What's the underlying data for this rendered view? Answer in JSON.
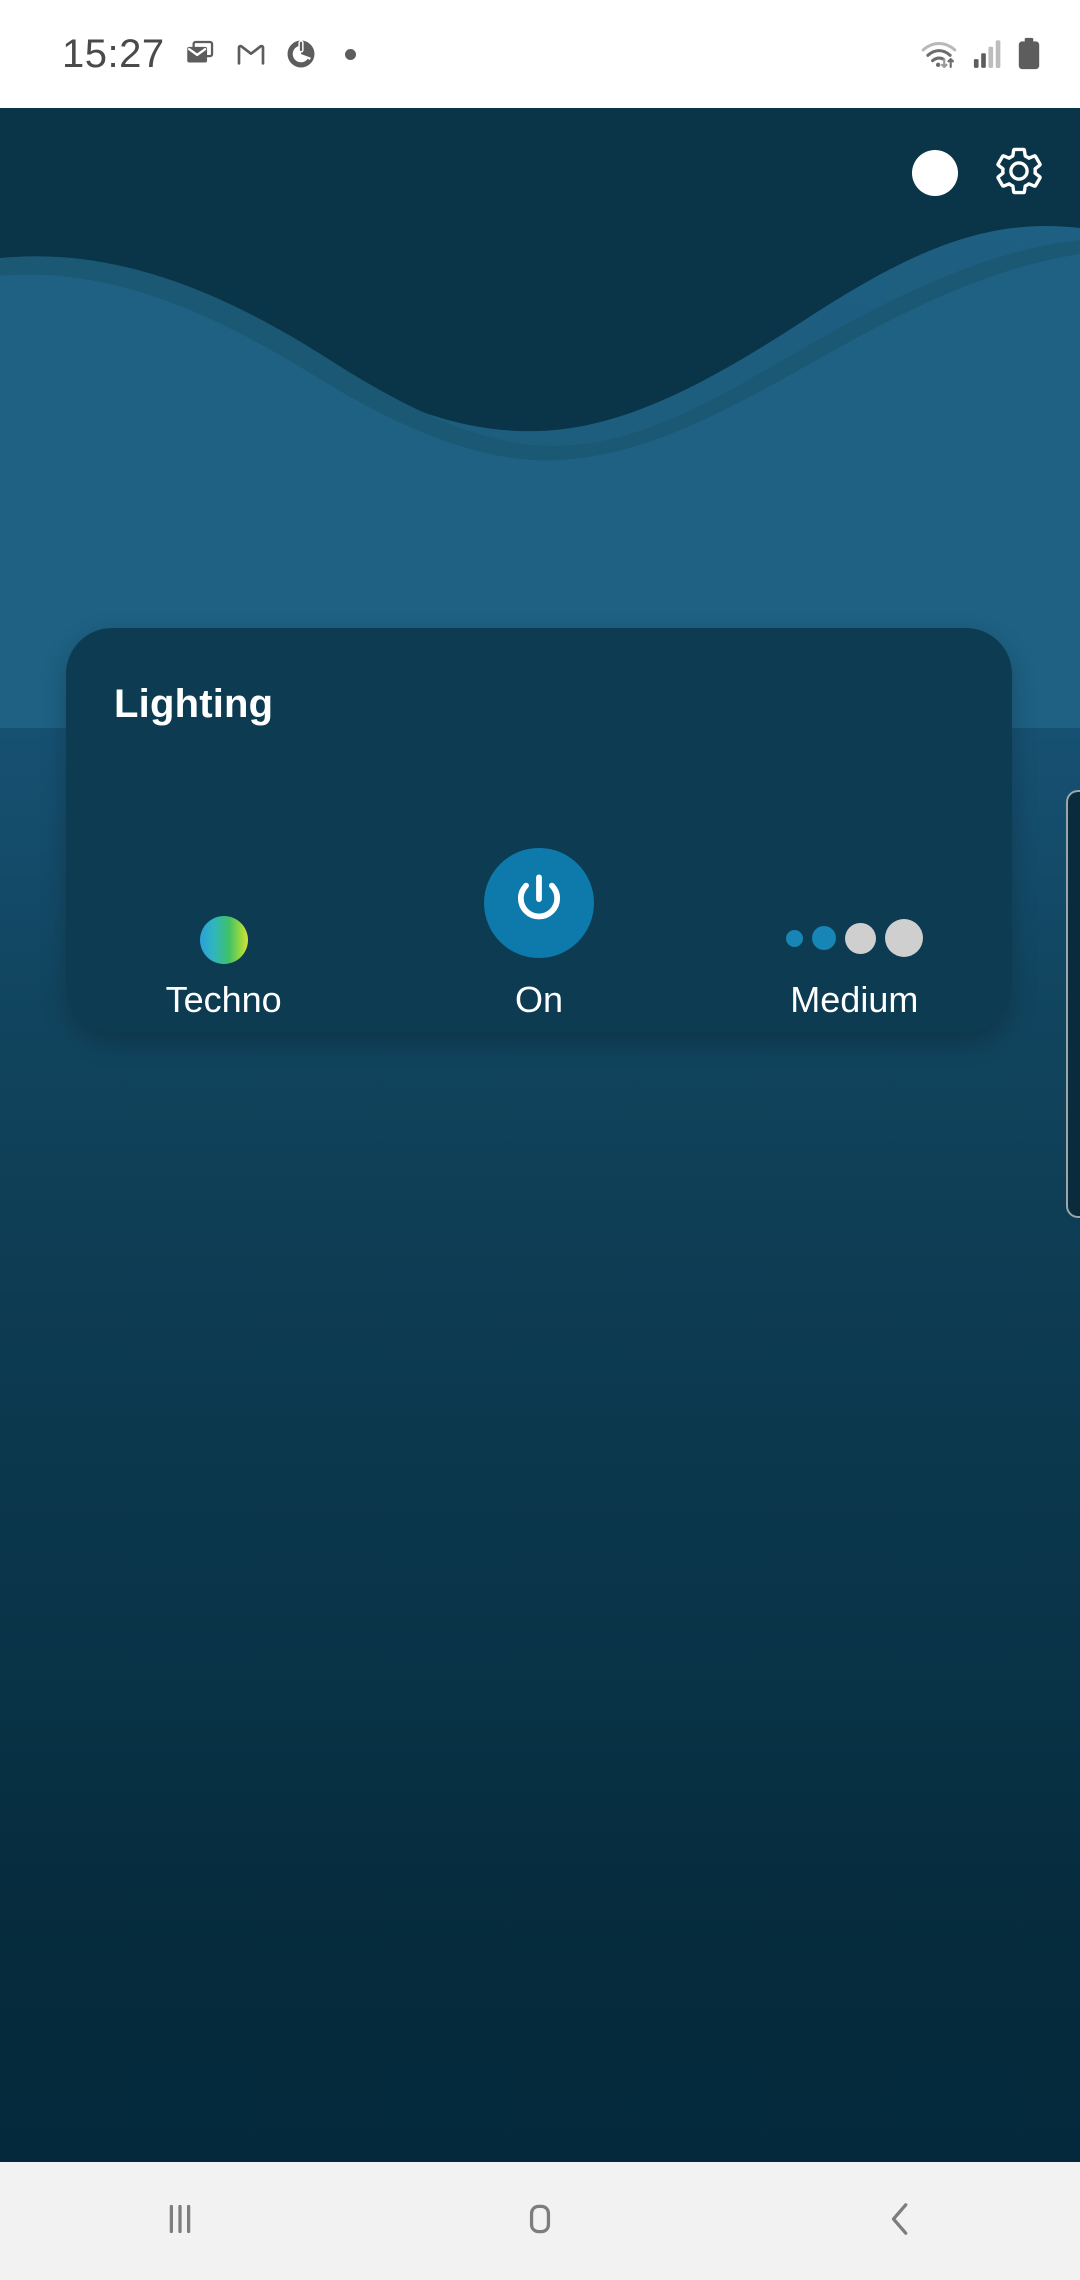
{
  "status_bar": {
    "clock": "15:27",
    "left_icons": [
      {
        "name": "email-icon",
        "label": "Email"
      },
      {
        "name": "gmail-icon",
        "label": "Gmail"
      },
      {
        "name": "battery-saver-icon",
        "label": "Battery saver"
      },
      {
        "name": "notification-dot-icon",
        "label": "More notifications"
      }
    ],
    "right_icons": [
      {
        "name": "wifi-icon",
        "label": "Wi-Fi"
      },
      {
        "name": "cellular-signal-icon",
        "label": "Signal"
      },
      {
        "name": "battery-icon",
        "label": "Battery"
      }
    ]
  },
  "top_controls": {
    "indicator_label": "Connected",
    "settings_label": "Settings"
  },
  "card": {
    "title": "Lighting",
    "controls": [
      {
        "name": "effect",
        "label": "Techno"
      },
      {
        "name": "power",
        "label": "On"
      },
      {
        "name": "brightness",
        "label": "Medium"
      }
    ],
    "brightness": {
      "levels": 4,
      "active": 2
    }
  },
  "nav_bar": {
    "recents_label": "Recents",
    "home_label": "Home",
    "back_label": "Back"
  },
  "colors": {
    "header_bg": "#0a3448",
    "wave_mid": "#1b5873",
    "wave_front": "#1e6183",
    "card_bg": "#0d3c52",
    "accent": "#0d7aab",
    "dot_on": "#1785b5",
    "dot_off": "#cfcfcf",
    "status_bg": "#ffffff",
    "nav_bg": "#f2f2f2"
  }
}
